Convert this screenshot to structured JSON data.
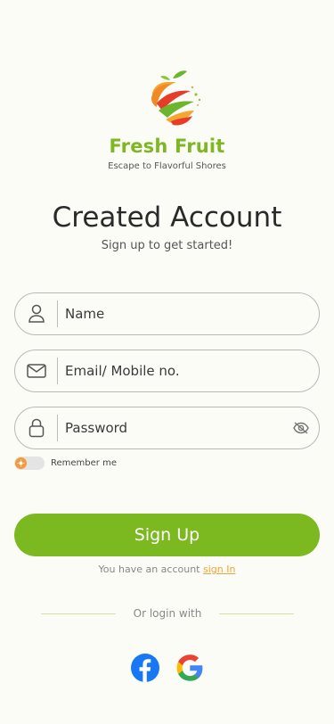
{
  "brand": {
    "name": "Fresh Fruit",
    "tagline": "Escape to Flavorful Shores"
  },
  "header": {
    "title": "Created Account",
    "subtitle": "Sign up to get started!"
  },
  "form": {
    "name_placeholder": "Name",
    "email_placeholder": "Email/ Mobile no.",
    "password_placeholder": "Password",
    "remember_label": "Remember me",
    "remember_checked": false
  },
  "actions": {
    "signup_label": "Sign Up",
    "have_account_text": "You have an account",
    "signin_link": "sign In"
  },
  "social": {
    "divider_text": "Or login with",
    "providers": [
      "facebook-icon",
      "google-icon"
    ]
  },
  "colors": {
    "primary": "#7cb820",
    "accent": "#f2a23a",
    "background": "#fbfcf6"
  }
}
